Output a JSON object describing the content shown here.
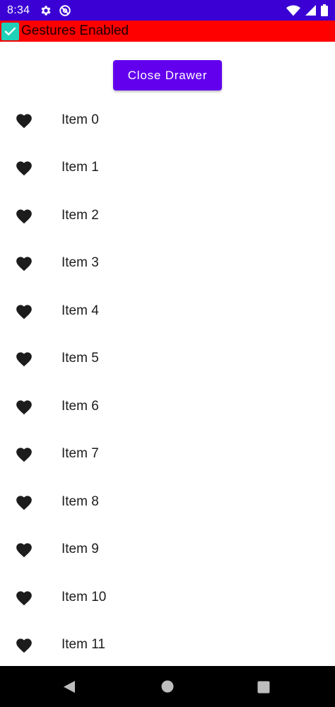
{
  "status_bar": {
    "time": "8:34",
    "background": "#3a00d4",
    "left_icons": [
      "gear-icon",
      "do-not-disturb-icon"
    ],
    "right_icons": [
      "wifi-icon",
      "cell-signal-icon",
      "battery-icon"
    ]
  },
  "gesture_toggle": {
    "label": "Gestures Enabled",
    "checked": true,
    "background": "#ff0000",
    "checkbox_color": "#1fd1b8"
  },
  "drawer": {
    "close_button_label": "Close Drawer",
    "accent": "#6200ee"
  },
  "list": {
    "icon": "heart-icon",
    "items": [
      {
        "label": "Item 0"
      },
      {
        "label": "Item 1"
      },
      {
        "label": "Item 2"
      },
      {
        "label": "Item 3"
      },
      {
        "label": "Item 4"
      },
      {
        "label": "Item 5"
      },
      {
        "label": "Item 6"
      },
      {
        "label": "Item 7"
      },
      {
        "label": "Item 8"
      },
      {
        "label": "Item 9"
      },
      {
        "label": "Item 10"
      },
      {
        "label": "Item 11"
      }
    ]
  },
  "nav_bar": {
    "buttons": [
      "back-icon",
      "home-icon",
      "recents-icon"
    ]
  }
}
